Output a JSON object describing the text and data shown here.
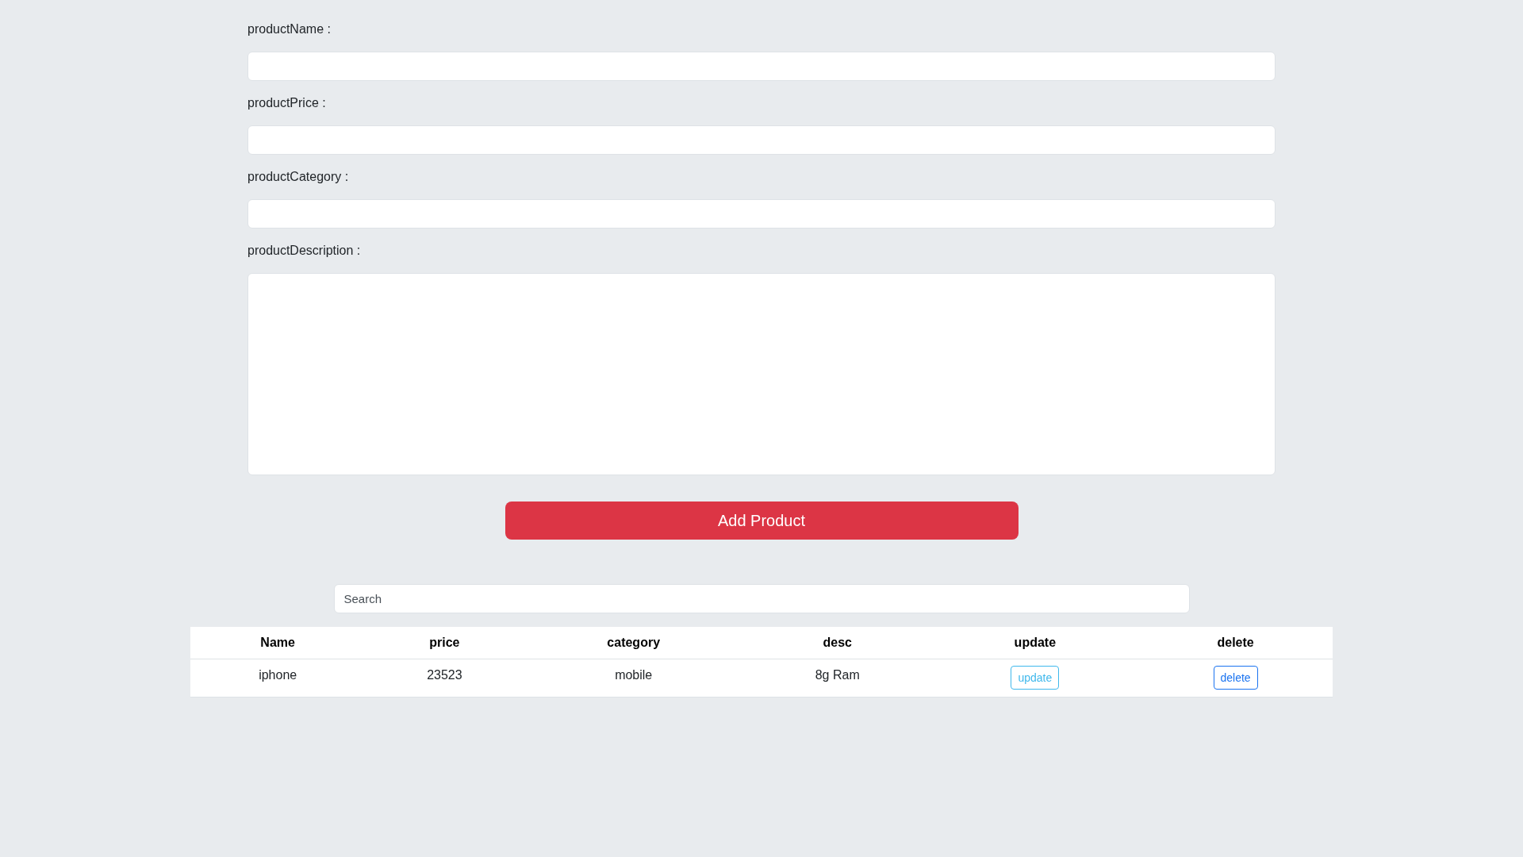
{
  "form": {
    "fields": [
      {
        "label": "productName :",
        "kind": "input"
      },
      {
        "label": "productPrice :",
        "kind": "input"
      },
      {
        "label": "productCategory :",
        "kind": "input"
      },
      {
        "label": "productDescription :",
        "kind": "textarea"
      }
    ],
    "submit_button": "Add Product"
  },
  "search": {
    "placeholder": "Search"
  },
  "table": {
    "columns": [
      "Name",
      "price",
      "category",
      "desc",
      "update",
      "delete"
    ],
    "rows": [
      {
        "cells": [
          "iphone",
          "23523",
          "mobile",
          "8g Ram"
        ],
        "actions": [
          {
            "kind": "update",
            "label": "update"
          },
          {
            "kind": "delete",
            "label": "delete"
          }
        ]
      }
    ]
  }
}
